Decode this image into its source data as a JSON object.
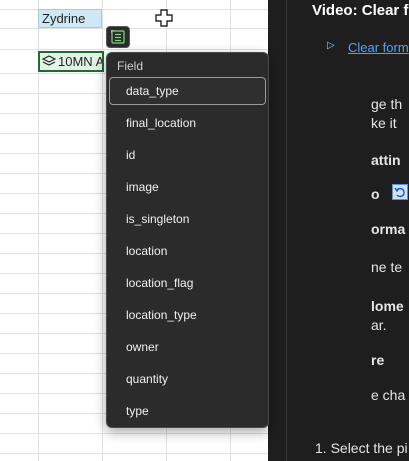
{
  "sheet": {
    "selected_cell_text": "Zydrine",
    "entity_cell_text": "10MN A"
  },
  "dropdown": {
    "header": "Field",
    "items": [
      {
        "label": "data_type",
        "active": true
      },
      {
        "label": "final_location"
      },
      {
        "label": "id"
      },
      {
        "label": "image"
      },
      {
        "label": "is_singleton"
      },
      {
        "label": "location"
      },
      {
        "label": "location_flag"
      },
      {
        "label": "location_type"
      },
      {
        "label": "owner"
      },
      {
        "label": "quantity"
      },
      {
        "label": "type"
      }
    ]
  },
  "help_pane": {
    "title": "Video: Clear f",
    "link": "Clear form",
    "fragments": [
      "ge th",
      "ke it",
      "attin",
      "o",
      "orma",
      "ne te",
      "lome",
      "ar.",
      "re",
      "e cha"
    ],
    "step1": "1.  Select the pi"
  },
  "colors": {
    "selected_cell": "#cfe8f5",
    "entity_border": "#1e6b34",
    "pane_bg": "#1e1e1e",
    "dropdown_bg": "#2b2b2b",
    "link": "#4ea3ff"
  }
}
